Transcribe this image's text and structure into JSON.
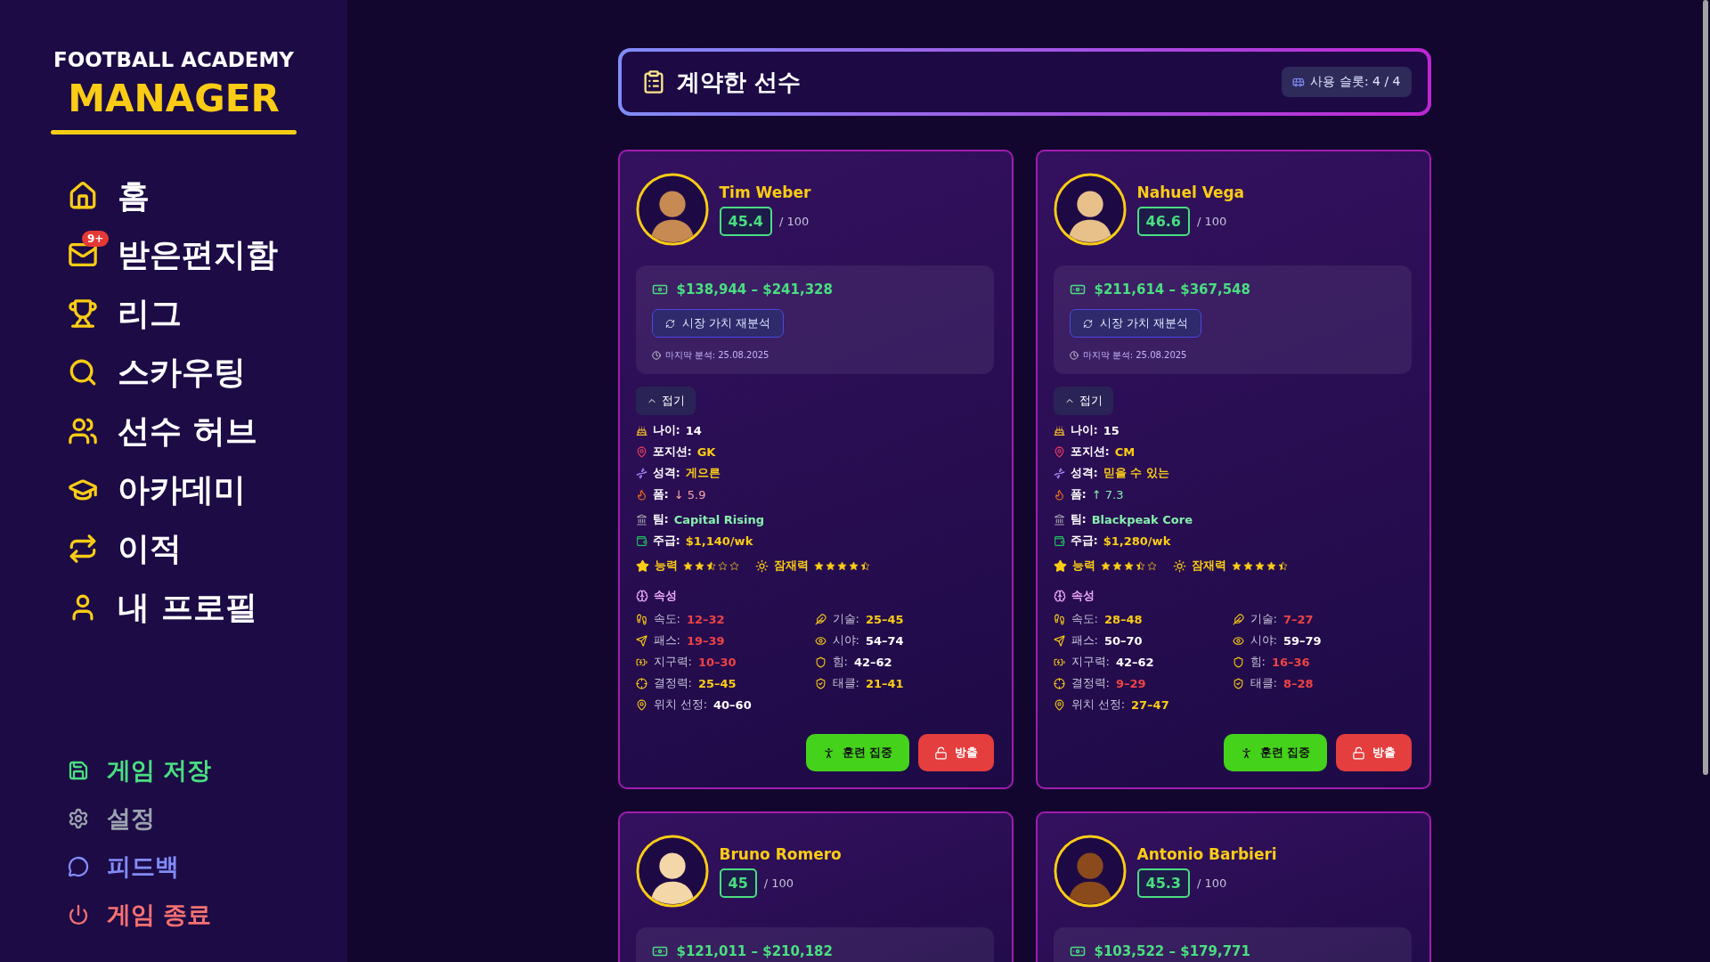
{
  "sidebar": {
    "logo": {
      "line1": "FOOTBALL ACADEMY",
      "line2": "MANAGER"
    },
    "nav": [
      {
        "label": "홈"
      },
      {
        "label": "받은편지함",
        "badge": "9+"
      },
      {
        "label": "리그"
      },
      {
        "label": "스카우팅"
      },
      {
        "label": "선수 허브"
      },
      {
        "label": "아카데미"
      },
      {
        "label": "이적"
      },
      {
        "label": "내 프로필"
      }
    ],
    "actions": [
      {
        "label": "게임 저장",
        "color": "#4ade80"
      },
      {
        "label": "설정",
        "color": "#9ca3af"
      },
      {
        "label": "피드백",
        "color": "#818cf8"
      },
      {
        "label": "게임 종료",
        "color": "#f87171"
      }
    ]
  },
  "header": {
    "title": "계약한 선수",
    "slots": "사용 슬롯: 4 / 4"
  },
  "players": [
    {
      "name": "Tim Weber",
      "rating": "45.4",
      "rating_max": "/ 100",
      "value_range": "$138,944 – $241,328",
      "reanalyze": "시장 가치 재분석",
      "last_analysis": "마지막 분석: 25.08.2025",
      "toggle": "접기",
      "expanded": true,
      "facts": [
        {
          "kind": "plain",
          "label": "나이:",
          "value": "14"
        },
        {
          "kind": "accent",
          "label": "포지션:",
          "value": "GK"
        },
        {
          "kind": "accent",
          "label": "성격:",
          "value": "게으른"
        },
        {
          "kind": "falling",
          "label": "폼:",
          "value": "↓ 5.9"
        },
        {
          "kind": "team",
          "label": "팀:",
          "value": "Capital Rising"
        },
        {
          "kind": "accent",
          "label": "주급:",
          "value": "$1,140/wk"
        }
      ],
      "ratings": [
        {
          "label": "능력",
          "stars": 2.5
        },
        {
          "label": "잠재력",
          "stars": 4.5
        }
      ],
      "attributes_title": "속성",
      "attributes": [
        {
          "label": "속도:",
          "value": "12–32",
          "color": "#ef4444"
        },
        {
          "label": "기술:",
          "value": "25–45",
          "color": "#facc15"
        },
        {
          "label": "패스:",
          "value": "19–39",
          "color": "#ef4444"
        },
        {
          "label": "시야:",
          "value": "54–74",
          "color": "#ffffff"
        },
        {
          "label": "지구력:",
          "value": "10–30",
          "color": "#ef4444"
        },
        {
          "label": "힘:",
          "value": "42–62",
          "color": "#ffffff"
        },
        {
          "label": "결정력:",
          "value": "25–45",
          "color": "#facc15"
        },
        {
          "label": "태클:",
          "value": "21–41",
          "color": "#facc15"
        },
        {
          "label": "위치 선정:",
          "value": "40–60",
          "color": "#ffffff"
        }
      ],
      "buttons": [
        {
          "kind": "train",
          "label": "훈련 집중"
        },
        {
          "kind": "release",
          "label": "방출"
        }
      ]
    },
    {
      "name": "Nahuel Vega",
      "rating": "46.6",
      "rating_max": "/ 100",
      "value_range": "$211,614 – $367,548",
      "reanalyze": "시장 가치 재분석",
      "last_analysis": "마지막 분석: 25.08.2025",
      "toggle": "접기",
      "expanded": true,
      "facts": [
        {
          "kind": "plain",
          "label": "나이:",
          "value": "15"
        },
        {
          "kind": "accent",
          "label": "포지션:",
          "value": "CM"
        },
        {
          "kind": "accent",
          "label": "성격:",
          "value": "믿을 수 있는"
        },
        {
          "kind": "rising",
          "label": "폼:",
          "value": "↑ 7.3"
        },
        {
          "kind": "team",
          "label": "팀:",
          "value": "Blackpeak Core"
        },
        {
          "kind": "accent",
          "label": "주급:",
          "value": "$1,280/wk"
        }
      ],
      "ratings": [
        {
          "label": "능력",
          "stars": 3.5
        },
        {
          "label": "잠재력",
          "stars": 4.5
        }
      ],
      "attributes_title": "속성",
      "attributes": [
        {
          "label": "속도:",
          "value": "28–48",
          "color": "#facc15"
        },
        {
          "label": "기술:",
          "value": "7–27",
          "color": "#ef4444"
        },
        {
          "label": "패스:",
          "value": "50–70",
          "color": "#ffffff"
        },
        {
          "label": "시야:",
          "value": "59–79",
          "color": "#ffffff"
        },
        {
          "label": "지구력:",
          "value": "42–62",
          "color": "#ffffff"
        },
        {
          "label": "힘:",
          "value": "16–36",
          "color": "#ef4444"
        },
        {
          "label": "결정력:",
          "value": "9–29",
          "color": "#ef4444"
        },
        {
          "label": "태클:",
          "value": "8–28",
          "color": "#ef4444"
        },
        {
          "label": "위치 선정:",
          "value": "27–47",
          "color": "#facc15"
        }
      ],
      "buttons": [
        {
          "kind": "train",
          "label": "훈련 집중"
        },
        {
          "kind": "release",
          "label": "방출"
        }
      ]
    },
    {
      "name": "Bruno Romero",
      "rating": "45",
      "rating_max": "/ 100",
      "value_range": "$121,011 – $210,182"
    },
    {
      "name": "Antonio Barbieri",
      "rating": "45.3",
      "rating_max": "/ 100",
      "value_range": "$103,522 – $179,771"
    }
  ]
}
